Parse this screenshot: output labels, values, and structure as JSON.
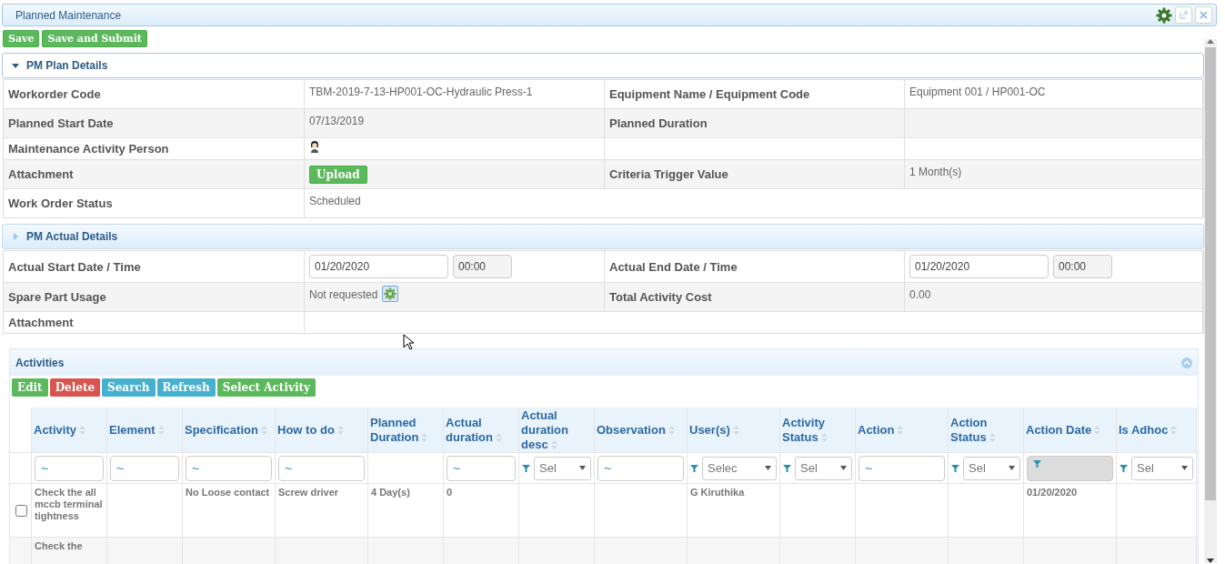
{
  "window": {
    "title": "Planned Maintenance"
  },
  "toolbar": [
    "Save",
    "Save and Submit"
  ],
  "plan_section": {
    "title": "PM Plan Details",
    "expanded": true,
    "rows": [
      {
        "cells": [
          {
            "kind": "label",
            "text": "Workorder Code"
          },
          {
            "kind": "value",
            "text": "TBM-2019-7-13-HP001-OC-Hydraulic Press-1"
          },
          {
            "kind": "label",
            "text": "Equipment Name / Equipment Code"
          },
          {
            "kind": "value",
            "text": "Equipment 001 / HP001-OC"
          }
        ]
      },
      {
        "cells": [
          {
            "kind": "label",
            "text": "Planned Start Date"
          },
          {
            "kind": "value",
            "text": "07/13/2019"
          },
          {
            "kind": "label",
            "text": "Planned Duration"
          },
          {
            "kind": "empty"
          }
        ]
      },
      {
        "cells": [
          {
            "kind": "label",
            "text": "Maintenance Activity Person"
          },
          {
            "kind": "person"
          },
          {
            "kind": "empty"
          },
          {
            "kind": "empty"
          }
        ]
      },
      {
        "cells": [
          {
            "kind": "label",
            "text": "Attachment"
          },
          {
            "kind": "upload",
            "text": "Upload"
          },
          {
            "kind": "label",
            "text": "Criteria Trigger Value"
          },
          {
            "kind": "value",
            "text": "1 Month(s)"
          }
        ]
      },
      {
        "cells": [
          {
            "kind": "label",
            "text": "Work Order Status"
          },
          {
            "kind": "wide",
            "text": "Scheduled"
          }
        ]
      }
    ]
  },
  "actual_section": {
    "title": "PM Actual Details",
    "expanded": false,
    "rows": [
      {
        "cells": [
          {
            "kind": "label",
            "text": "Actual Start Date / Time"
          },
          {
            "kind": "datetime",
            "date": "01/20/2020",
            "time": "00:00"
          },
          {
            "kind": "label",
            "text": "Actual End Date / Time"
          },
          {
            "kind": "datetime",
            "date": "01/20/2020",
            "time": "00:00"
          }
        ]
      },
      {
        "cells": [
          {
            "kind": "label",
            "text": "Spare Part Usage"
          },
          {
            "kind": "spare",
            "text": "Not requested"
          },
          {
            "kind": "label",
            "text": "Total Activity Cost"
          },
          {
            "kind": "value",
            "text": "0.00"
          }
        ]
      },
      {
        "cells": [
          {
            "kind": "label",
            "text": "Attachment"
          },
          {
            "kind": "wide"
          }
        ]
      }
    ]
  },
  "activities": {
    "title": "Activities",
    "buttons": [
      {
        "label": "Edit",
        "color": "#5cb85c"
      },
      {
        "label": "Delete",
        "color": "#d9534f"
      },
      {
        "label": "Search",
        "color": "#46b0cf"
      },
      {
        "label": "Refresh",
        "color": "#46b0cf"
      },
      {
        "label": "Select Activity",
        "color": "#5cb85c"
      }
    ],
    "columns": [
      {
        "label": "Activity",
        "filter": {
          "kind": "text",
          "value": "~"
        }
      },
      {
        "label": "Element",
        "filter": {
          "kind": "text",
          "value": "~"
        }
      },
      {
        "label": "Specification",
        "filter": {
          "kind": "text",
          "value": "~"
        }
      },
      {
        "label": "How to do",
        "filter": {
          "kind": "text",
          "value": "~"
        }
      },
      {
        "label": "Planned Duration",
        "filter": {
          "kind": "none"
        }
      },
      {
        "label": "Actual duration",
        "filter": {
          "kind": "text",
          "value": "~"
        }
      },
      {
        "label": "Actual duration desc",
        "filter": {
          "kind": "select",
          "value": "Sel"
        }
      },
      {
        "label": "Observation",
        "filter": {
          "kind": "text",
          "value": "~"
        }
      },
      {
        "label": "User(s)",
        "filter": {
          "kind": "select",
          "value": "Selec"
        }
      },
      {
        "label": "Activity Status",
        "filter": {
          "kind": "select",
          "value": "Sel"
        }
      },
      {
        "label": "Action",
        "filter": {
          "kind": "text",
          "value": "~"
        }
      },
      {
        "label": "Action Status",
        "filter": {
          "kind": "select",
          "value": "Sel"
        }
      },
      {
        "label": "Action Date",
        "filter": {
          "kind": "disabled"
        }
      },
      {
        "label": "Is Adhoc",
        "filter": {
          "kind": "select",
          "value": "Sel"
        }
      }
    ],
    "rows": [
      {
        "checked": false,
        "cells": [
          "Check the all mccb terminal tightness",
          "",
          "No Loose contact",
          "Screw driver",
          "4 Day(s)",
          "0",
          "",
          "",
          "G Kiruthika",
          "",
          "",
          "",
          "01/20/2020",
          ""
        ]
      },
      {
        "cells": [
          "Check the",
          "",
          "",
          "",
          "",
          "",
          "",
          "",
          "",
          "",
          "",
          "",
          "",
          ""
        ]
      }
    ]
  }
}
